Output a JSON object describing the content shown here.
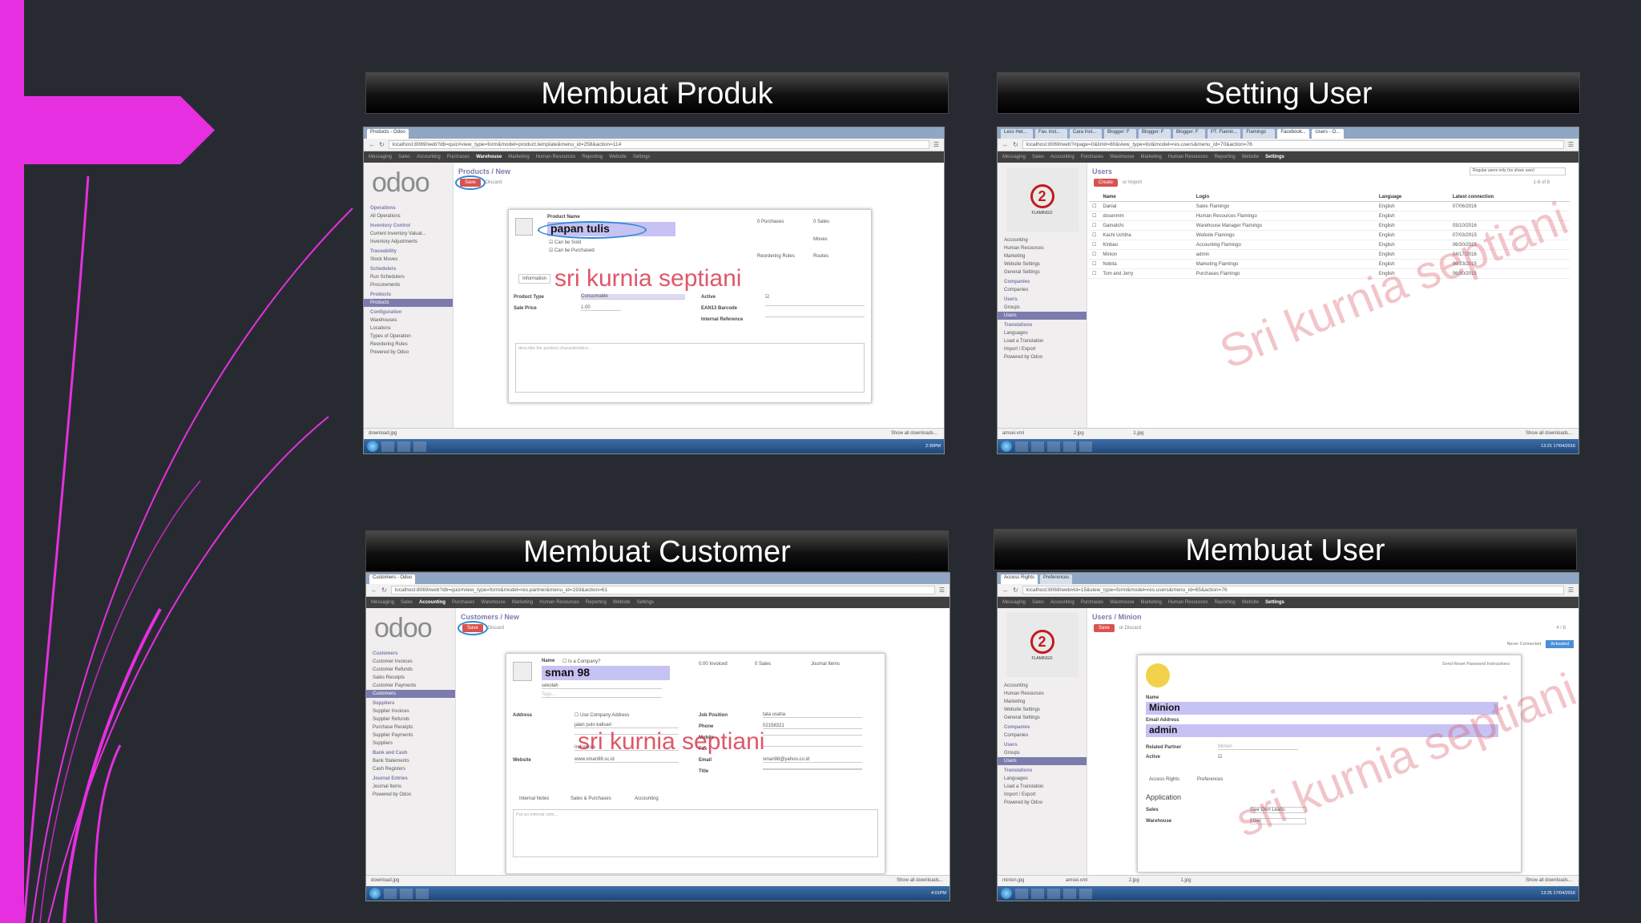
{
  "titles": {
    "produk": "Membuat Produk",
    "setting_user": "Setting User",
    "customer": "Membuat Customer",
    "user": "Membuat User"
  },
  "watermark": "sri kurnia septiani",
  "watermark_alt": "Sri kurnia septiani",
  "colors": {
    "accent": "#e62fe0",
    "background": "#272b31",
    "odoo_purple": "#7c7bad",
    "save_red": "#d9534f",
    "highlight": "#c6c2f4"
  },
  "shot_produk": {
    "tab": "Products - Odoo",
    "url": "localhost:8069/web?db=quiz#view_type=form&model=product.template&menu_id=258&action=114",
    "menu": [
      "Messaging",
      "Sales",
      "Accounting",
      "Purchases",
      "Warehouse",
      "Marketing",
      "Human Resources",
      "Reporting",
      "Website",
      "Settings"
    ],
    "logo": "odoo",
    "sidebar": [
      {
        "label": "Operations",
        "type": "hdr"
      },
      {
        "label": "All Operations"
      },
      {
        "label": "Inventory Control",
        "type": "hdr"
      },
      {
        "label": "Current Inventory Valuat..."
      },
      {
        "label": "Inventory Adjustments"
      },
      {
        "label": "Traceability",
        "type": "hdr"
      },
      {
        "label": "Stock Moves"
      },
      {
        "label": "Schedulers",
        "type": "hdr"
      },
      {
        "label": "Run Schedulers"
      },
      {
        "label": "Procurements"
      },
      {
        "label": "Products",
        "type": "hdr"
      },
      {
        "label": "Products",
        "type": "sel"
      },
      {
        "label": "Configuration",
        "type": "hdr"
      },
      {
        "label": "Warehouses"
      },
      {
        "label": "Locations"
      },
      {
        "label": "Types of Operation"
      },
      {
        "label": "Reordering Rules"
      },
      {
        "label": "Powered by Odoo"
      }
    ],
    "breadcrumb": "Products / New",
    "save": "Save",
    "discard": "Discard",
    "product_name_label": "Product Name",
    "product_name": "papan tulis",
    "can_be_sold": "Can be Sold",
    "can_be_purchased": "Can be Purchased",
    "stat_purchases": "0 Purchases",
    "stat_sales": "0 Sales",
    "stat_moves": "Moves",
    "stat_reordering": "Reordering Rules",
    "stat_routes": "Routes",
    "tab_information": "Information",
    "product_type_label": "Product Type",
    "product_type": "Consumable",
    "sale_price_label": "Sale Price",
    "sale_price": "1.00",
    "active_label": "Active",
    "ean_label": "EAN13 Barcode",
    "internal_ref_label": "Internal Reference",
    "description_placeholder": "describe the product characteristics...",
    "download": "download.jpg",
    "show_downloads": "Show all downloads...",
    "clock": "2:30PM"
  },
  "shot_setting": {
    "tabs": [
      "Less Het...",
      "Fav. inst...",
      "Cara Inst...",
      "Blogger: F",
      "Blogger: F",
      "Blogger: F",
      "PT. Flamin...",
      "Flamingo",
      "Facebook...",
      "Users - O..."
    ],
    "url": "localhost:8069/web?#page=0&limit=80&view_type=list&model=res.users&menu_id=70&action=76",
    "menu": [
      "Messaging",
      "Sales",
      "Accounting",
      "Purchases",
      "Warehouse",
      "Marketing",
      "Human Resources",
      "Reporting",
      "Website",
      "Settings"
    ],
    "logo_text": "FLAMINGO",
    "sidebar": [
      {
        "label": "Accounting"
      },
      {
        "label": "Human Resources"
      },
      {
        "label": "Marketing"
      },
      {
        "label": "Website Settings"
      },
      {
        "label": "General Settings"
      },
      {
        "label": "Companies",
        "type": "hdr"
      },
      {
        "label": "Companies"
      },
      {
        "label": "Users",
        "type": "hdr"
      },
      {
        "label": "Groups"
      },
      {
        "label": "Users",
        "type": "sel"
      },
      {
        "label": "Translations",
        "type": "hdr"
      },
      {
        "label": "Languages"
      },
      {
        "label": "Load a Translation"
      },
      {
        "label": "Import / Export"
      },
      {
        "label": "Powered by Odoo"
      }
    ],
    "breadcrumb": "Users",
    "create": "Create",
    "import": "or Import",
    "search_placeholder": "Regular users only (no share user)",
    "pager": "1-8 of 8",
    "columns": [
      "Name",
      "Login",
      "Language",
      "Latest connection"
    ],
    "rows": [
      [
        "Danial",
        "Sales Flamingo",
        "English",
        "07/06/2016"
      ],
      [
        "dosenmm",
        "Human Resources Flamingo",
        "English",
        ""
      ],
      [
        "Gamatchi",
        "Warehouse Manager Flamingo",
        "English",
        "03/10/2016"
      ],
      [
        "Kachi Uchiha",
        "Website Flamingo",
        "English",
        "07/03/2015"
      ],
      [
        "Kinbao",
        "Accounting Flamingo",
        "English",
        "06/30/2015"
      ],
      [
        "Minion",
        "admin",
        "English",
        "04/17/2016"
      ],
      [
        "Nobita",
        "Marketing Flamingo",
        "English",
        "06/23/2015"
      ],
      [
        "Tom and Jerry",
        "Purchases Flamingo",
        "English",
        "06/30/2015"
      ]
    ],
    "downloads": [
      "amsei.xml",
      "2.jpg",
      "1.jpg"
    ],
    "show_downloads": "Show all downloads...",
    "clock": "13:21\n17/04/2016"
  },
  "shot_customer": {
    "tab": "Customers - Odoo",
    "url": "localhost:8069/web?db=quiz#view_type=form&model=res.partner&menu_id=193&action=61",
    "menu": [
      "Messaging",
      "Sales",
      "Accounting",
      "Purchases",
      "Warehouse",
      "Marketing",
      "Human Resources",
      "Reporting",
      "Website",
      "Settings"
    ],
    "logo": "odoo",
    "sidebar": [
      {
        "label": "Customers",
        "type": "hdr"
      },
      {
        "label": "Customer Invoices"
      },
      {
        "label": "Customer Refunds"
      },
      {
        "label": "Sales Receipts"
      },
      {
        "label": "Customer Payments"
      },
      {
        "label": "Customers",
        "type": "sel"
      },
      {
        "label": "Suppliers",
        "type": "hdr"
      },
      {
        "label": "Supplier Invoices"
      },
      {
        "label": "Supplier Refunds"
      },
      {
        "label": "Purchase Receipts"
      },
      {
        "label": "Supplier Payments"
      },
      {
        "label": "Suppliers"
      },
      {
        "label": "Bank and Cash",
        "type": "hdr"
      },
      {
        "label": "Bank Statements"
      },
      {
        "label": "Cash Registers"
      },
      {
        "label": "Journal Entries",
        "type": "hdr"
      },
      {
        "label": "Journal Items"
      },
      {
        "label": "Powered by Odoo"
      }
    ],
    "breadcrumb": "Customers / New",
    "save": "Save",
    "discard": "Discard",
    "name_label": "Name",
    "is_company": "Is a Company?",
    "name": "sman 98",
    "company_field": "sekolah",
    "tags_placeholder": "Tags...",
    "stat_invoiced": "0.00 Invoiced",
    "stat_sales": "0 Sales",
    "stat_journal": "Journal Items",
    "address_label": "Address",
    "use_company_address": "Use Company Address",
    "street": "jalan pulo kalisari",
    "country": "Indonesia",
    "website_label": "Website",
    "website": "www.sman98.sc.id",
    "job_label": "Job Position",
    "job": "tata usaha",
    "phone_label": "Phone",
    "phone": "02158321",
    "mobile_label": "Mobile",
    "fax_label": "Fax",
    "email_label": "Email",
    "email": "sman98@yahoo.co.id",
    "title_label": "Title",
    "tabs": [
      "Internal Notes",
      "Sales & Purchases",
      "Accounting"
    ],
    "note_placeholder": "Put an internal note...",
    "download": "download.jpg",
    "show_downloads": "Show all downloads...",
    "clock": "4:01PM"
  },
  "shot_user": {
    "tabs": [
      "Access Rights",
      "Preferences"
    ],
    "url": "localhost:8069/web#id=15&view_type=form&model=res.users&menu_id=65&action=76",
    "menu": [
      "Messaging",
      "Sales",
      "Accounting",
      "Purchases",
      "Warehouse",
      "Marketing",
      "Human Resources",
      "Reporting",
      "Website",
      "Settings"
    ],
    "logo_text": "FLAMINGO",
    "sidebar": [
      {
        "label": "Accounting"
      },
      {
        "label": "Human Resources"
      },
      {
        "label": "Marketing"
      },
      {
        "label": "Website Settings"
      },
      {
        "label": "General Settings"
      },
      {
        "label": "Companies",
        "type": "hdr"
      },
      {
        "label": "Companies"
      },
      {
        "label": "Users",
        "type": "hdr"
      },
      {
        "label": "Groups"
      },
      {
        "label": "Users",
        "type": "sel"
      },
      {
        "label": "Translations",
        "type": "hdr"
      },
      {
        "label": "Languages"
      },
      {
        "label": "Load a Translation"
      },
      {
        "label": "Import / Export"
      },
      {
        "label": "Powered by Odoo"
      }
    ],
    "breadcrumb": "Users / Minion",
    "save": "Save",
    "discard": "or Discard",
    "pager": "4 / 8",
    "never_connected": "Never Connected",
    "activated": "Activated",
    "send_reset": "Send Reset Password Instructions",
    "name_label": "Name",
    "name": "Minion",
    "email_label": "Email Address",
    "email": "admin",
    "related_partner_label": "Related Partner",
    "related_partner": "Minion",
    "active_label": "Active",
    "application_label": "Application",
    "sales_label": "Sales",
    "sales_value": "See Own Leads",
    "warehouse_label": "Warehouse",
    "warehouse_value": "User",
    "downloads": [
      "minion.jpg",
      "amsei.xml",
      "2.jpg",
      "1.jpg"
    ],
    "show_downloads": "Show all downloads...",
    "clock": "13:25\n17/04/2016"
  }
}
